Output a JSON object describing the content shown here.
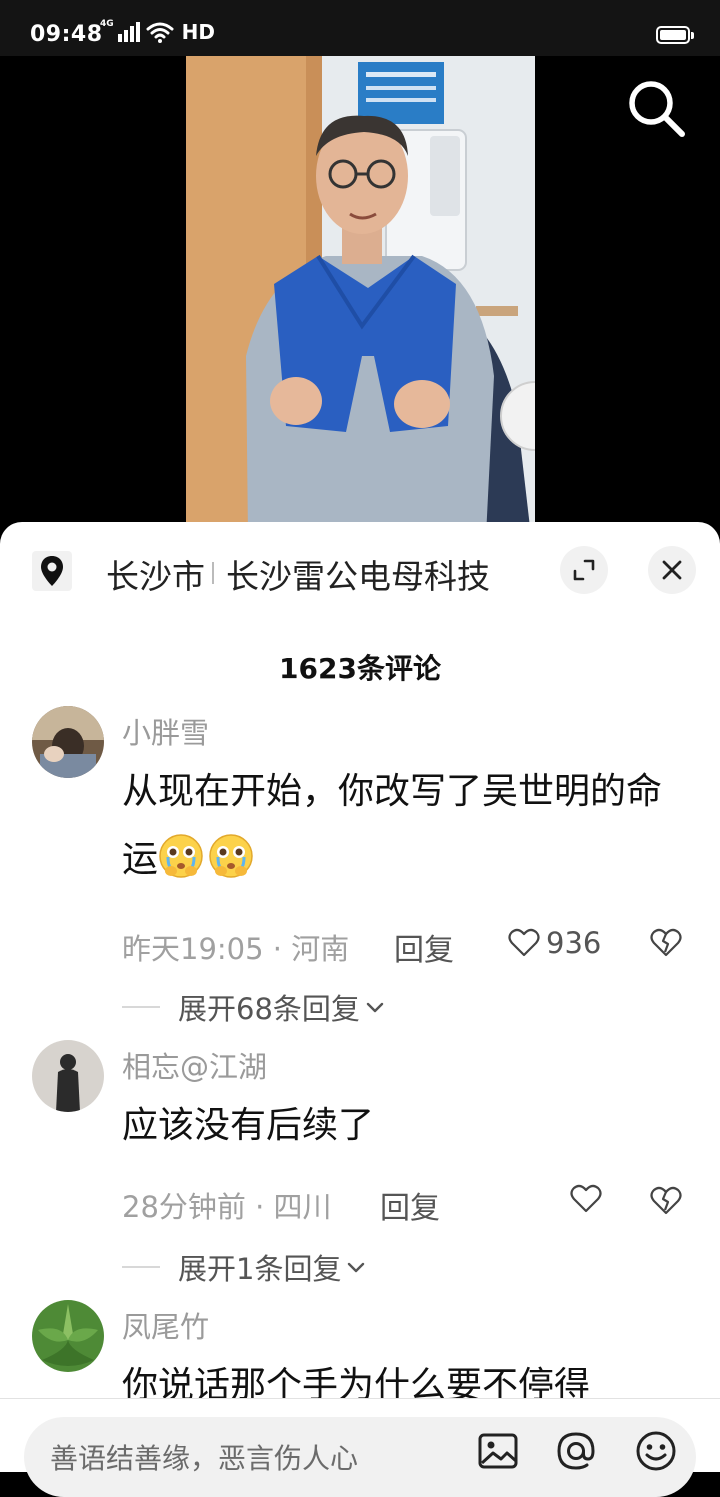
{
  "status_bar": {
    "time": "09:48",
    "network": "4G",
    "hd": "HD"
  },
  "location": {
    "city": "长沙市",
    "place": "长沙雷公电母科技"
  },
  "comments_header": {
    "count_text": "1623条评论"
  },
  "comments": [
    {
      "user": "小胖雪",
      "text": "从现在开始，你改写了吴世明的命运",
      "time_loc": "昨天19:05 · 河南",
      "reply_label": "回复",
      "likes": "936",
      "expand_text": "展开68条回复"
    },
    {
      "user": "相忘@江湖",
      "text": "应该没有后续了",
      "time_loc": "28分钟前 · 四川",
      "reply_label": "回复",
      "expand_text": "展开1条回复"
    },
    {
      "user": "凤尾竹",
      "text": "你说话那个手为什么要不停得"
    }
  ],
  "input_bar": {
    "placeholder": "善语结善缘，恶言伤人心"
  },
  "icons": {
    "search": "search-icon",
    "location_pin": "location-pin-icon",
    "expand": "expand-icon",
    "close": "close-icon",
    "heart": "heart-icon",
    "broken_heart": "broken-heart-icon",
    "chevron": "chevron-down-icon",
    "image": "image-icon",
    "at": "at-icon",
    "emoji": "emoji-icon"
  }
}
